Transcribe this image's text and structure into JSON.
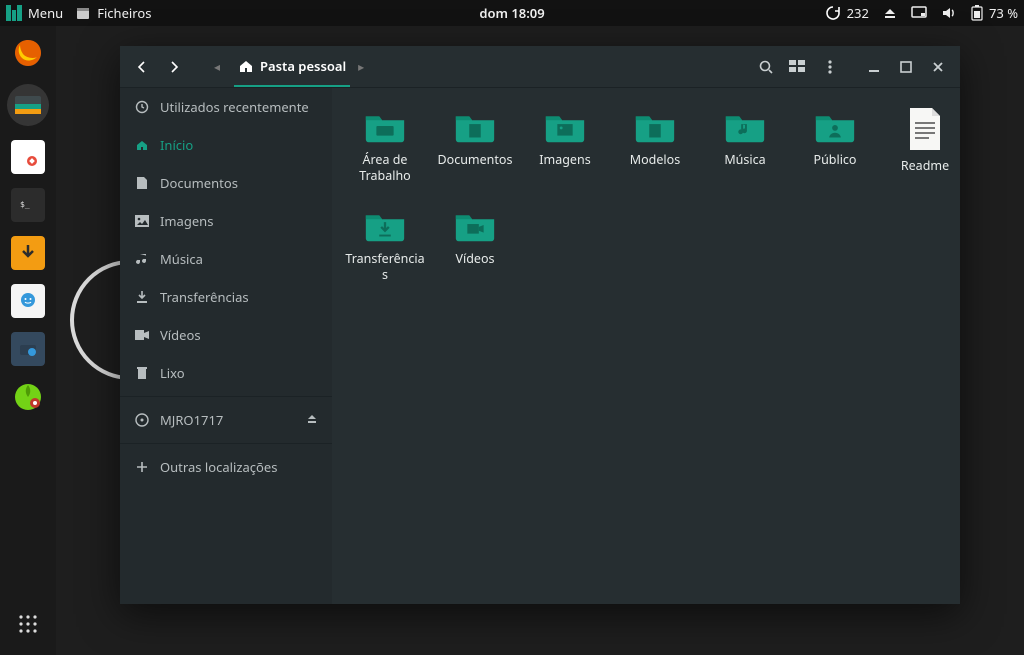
{
  "panel": {
    "menu_label": "Menu",
    "active_app": "Ficheiros",
    "clock": "dom 18:09",
    "updates_count": "232",
    "battery": "73 %"
  },
  "window": {
    "path_label": "Pasta pessoal",
    "sidebar": [
      {
        "icon": "clock",
        "label": "Utilizados recentemente",
        "active": false
      },
      {
        "icon": "home",
        "label": "Início",
        "active": true
      },
      {
        "icon": "doc",
        "label": "Documentos",
        "active": false
      },
      {
        "icon": "image",
        "label": "Imagens",
        "active": false
      },
      {
        "icon": "music",
        "label": "Música",
        "active": false
      },
      {
        "icon": "download",
        "label": "Transferências",
        "active": false
      },
      {
        "icon": "video",
        "label": "Vídeos",
        "active": false
      },
      {
        "icon": "trash",
        "label": "Lixo",
        "active": false
      }
    ],
    "devices": [
      {
        "icon": "disc",
        "label": "MJRO1717",
        "ejectable": true
      }
    ],
    "other_locations_label": "Outras localizações",
    "items": [
      {
        "type": "folder",
        "glyph": "desktop",
        "label": "Área de Trabalho"
      },
      {
        "type": "folder",
        "glyph": "doc",
        "label": "Documentos"
      },
      {
        "type": "folder",
        "glyph": "image",
        "label": "Imagens"
      },
      {
        "type": "folder",
        "glyph": "doc",
        "label": "Modelos"
      },
      {
        "type": "folder",
        "glyph": "music",
        "label": "Música"
      },
      {
        "type": "folder",
        "glyph": "public",
        "label": "Público"
      },
      {
        "type": "file",
        "glyph": "text",
        "label": "Readme"
      },
      {
        "type": "folder",
        "glyph": "download",
        "label": "Transferências"
      },
      {
        "type": "folder",
        "glyph": "video",
        "label": "Vídeos"
      }
    ]
  },
  "colors": {
    "accent": "#16a085"
  }
}
